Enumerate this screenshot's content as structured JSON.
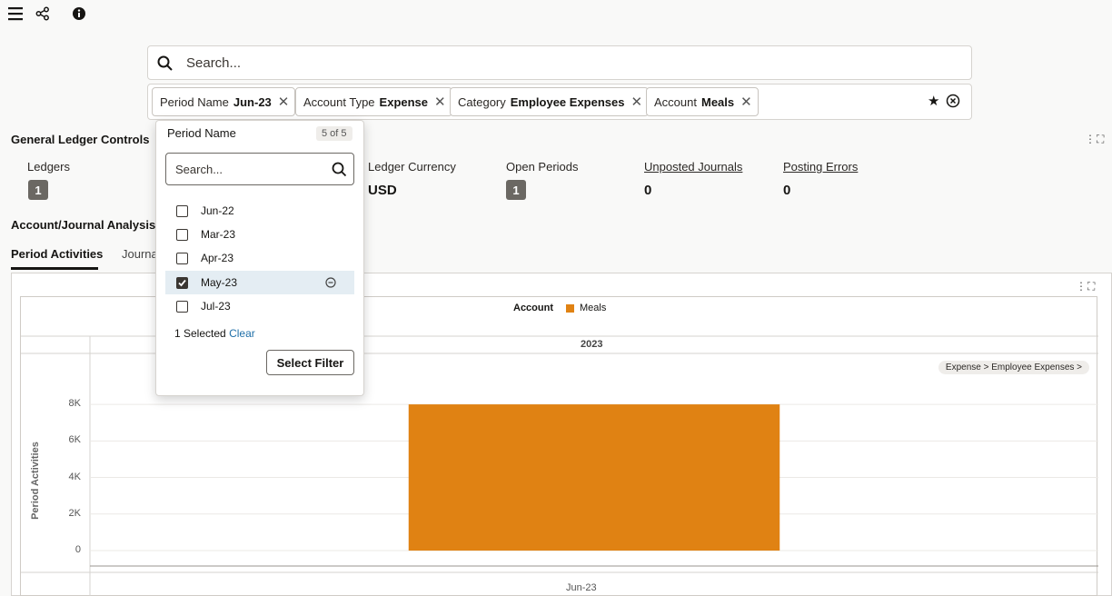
{
  "topbar": {
    "menu_icon": "hamburger-icon",
    "share_icon": "share-icon",
    "info_icon": "info-icon"
  },
  "search": {
    "placeholder": "Search..."
  },
  "filters": [
    {
      "key": "Period Name",
      "value": "Jun-23"
    },
    {
      "key": "Account Type",
      "value": "Expense"
    },
    {
      "key": "Category",
      "value": "Employee Expenses"
    },
    {
      "key": "Account",
      "value": "Meals"
    }
  ],
  "gl_controls": {
    "title": "General Ledger Controls",
    "metrics": [
      {
        "label": "Ledgers",
        "value": "1"
      },
      {
        "label": "Ledger Currency",
        "value": "USD"
      },
      {
        "label": "Open Periods",
        "value": "1"
      },
      {
        "label": "Unposted Journals",
        "value": "0"
      },
      {
        "label": "Posting Errors",
        "value": "0"
      }
    ]
  },
  "analysis": {
    "title": "Account/Journal Analysis",
    "tabs": [
      "Period Activities",
      "Journa"
    ]
  },
  "dropdown": {
    "title": "Period Name",
    "count": "5 of 5",
    "search_placeholder": "Search...",
    "options": [
      {
        "label": "Jun-22",
        "checked": false
      },
      {
        "label": "Mar-23",
        "checked": false
      },
      {
        "label": "Apr-23",
        "checked": false
      },
      {
        "label": "May-23",
        "checked": true
      },
      {
        "label": "Jul-23",
        "checked": false
      }
    ],
    "selected_text": "1 Selected",
    "clear_label": "Clear",
    "select_filter_label": "Select Filter"
  },
  "chart_data": {
    "type": "bar",
    "legend_title": "Account",
    "year_header": "2023",
    "breadcrumb": "Expense > Employee Expenses >",
    "ylabel": "Period Activities",
    "yticks": [
      "0",
      "2K",
      "4K",
      "6K",
      "8K"
    ],
    "ylim": [
      0,
      8800
    ],
    "categories": [
      "Jun-23"
    ],
    "series": [
      {
        "name": "Meals",
        "values": [
          8000
        ],
        "color": "#e08213"
      }
    ],
    "grid": true,
    "legend_position": "top-center"
  }
}
